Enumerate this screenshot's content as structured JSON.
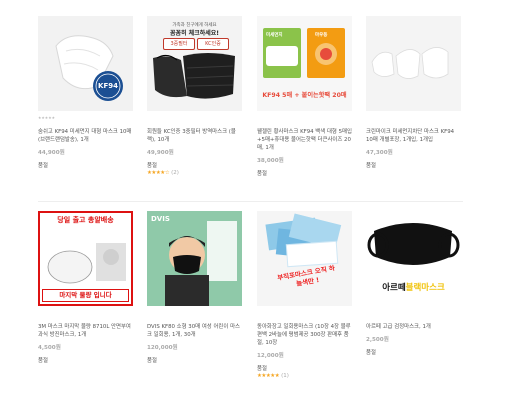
{
  "products": [
    {
      "title": "숨쉬고 KF94 미세먼지 대형 마스크 10매 (브랜드랜덤발송), 1개",
      "price": "44,900원",
      "status": "품절",
      "badge": "KF94",
      "small": "★★★★★"
    },
    {
      "title": "회원들 KC인증 3중필터 방역마스크 (블랙), 10개",
      "price": "49,900원",
      "status": "품절",
      "banner_top": "가족과 친구에게 하세요",
      "banner_main": "꼼꼼히 체크하세요!",
      "chip_left": "3중필터",
      "chip_right": "KC인증",
      "stars": "★★★★☆",
      "star_count": "(2)"
    },
    {
      "title": "웰젤린 황사마스크 KF94 백색 대형 5매입+5매+휴대용 물어는핫팩 더큰사이즈 20매, 1개",
      "price": "38,000원",
      "status": "품절",
      "promo": "KF94 5매 + 붙이는핫팩 20매",
      "pack_label": "미세먼지",
      "pack_label2": "마우동"
    },
    {
      "title": "크린마이크 미세먼지차단 마스크 KF94 10매 개별포장, 1개입, 1개입",
      "price": "47,300원",
      "status": "품절"
    },
    {
      "title": "3M 마스크 마지막 물량 8710L 안면부여과식 방진마스크, 1개",
      "price": "4,500원",
      "status": "품절",
      "banner_top": "당일 출고 총알배송",
      "banner_bottom": "마지막 물량 입니다"
    },
    {
      "title": "DVIS KF80 소형 30매 여성 어린이 마스크 일회용, 1개, 30개",
      "price": "120,000원",
      "status": "품절",
      "brand": "DVIS"
    },
    {
      "title": "동아화장고 일회용마스크 (10장 4장 블루편백 2바늘에 평범제공 300장 판매후 품절, 10장",
      "price": "12,000원",
      "status": "품절",
      "overlay": "부직포마스크 오직 하늘색만 !",
      "stars": "★★★★★",
      "star_count": "(1)"
    },
    {
      "title": "아르떼 고급 검정마스크, 1개",
      "price": "2,500원",
      "status": "품절",
      "overlay": "아르떼블랙마스크",
      "overlay_a": "아르떼",
      "overlay_b": "블랙마스크"
    }
  ]
}
